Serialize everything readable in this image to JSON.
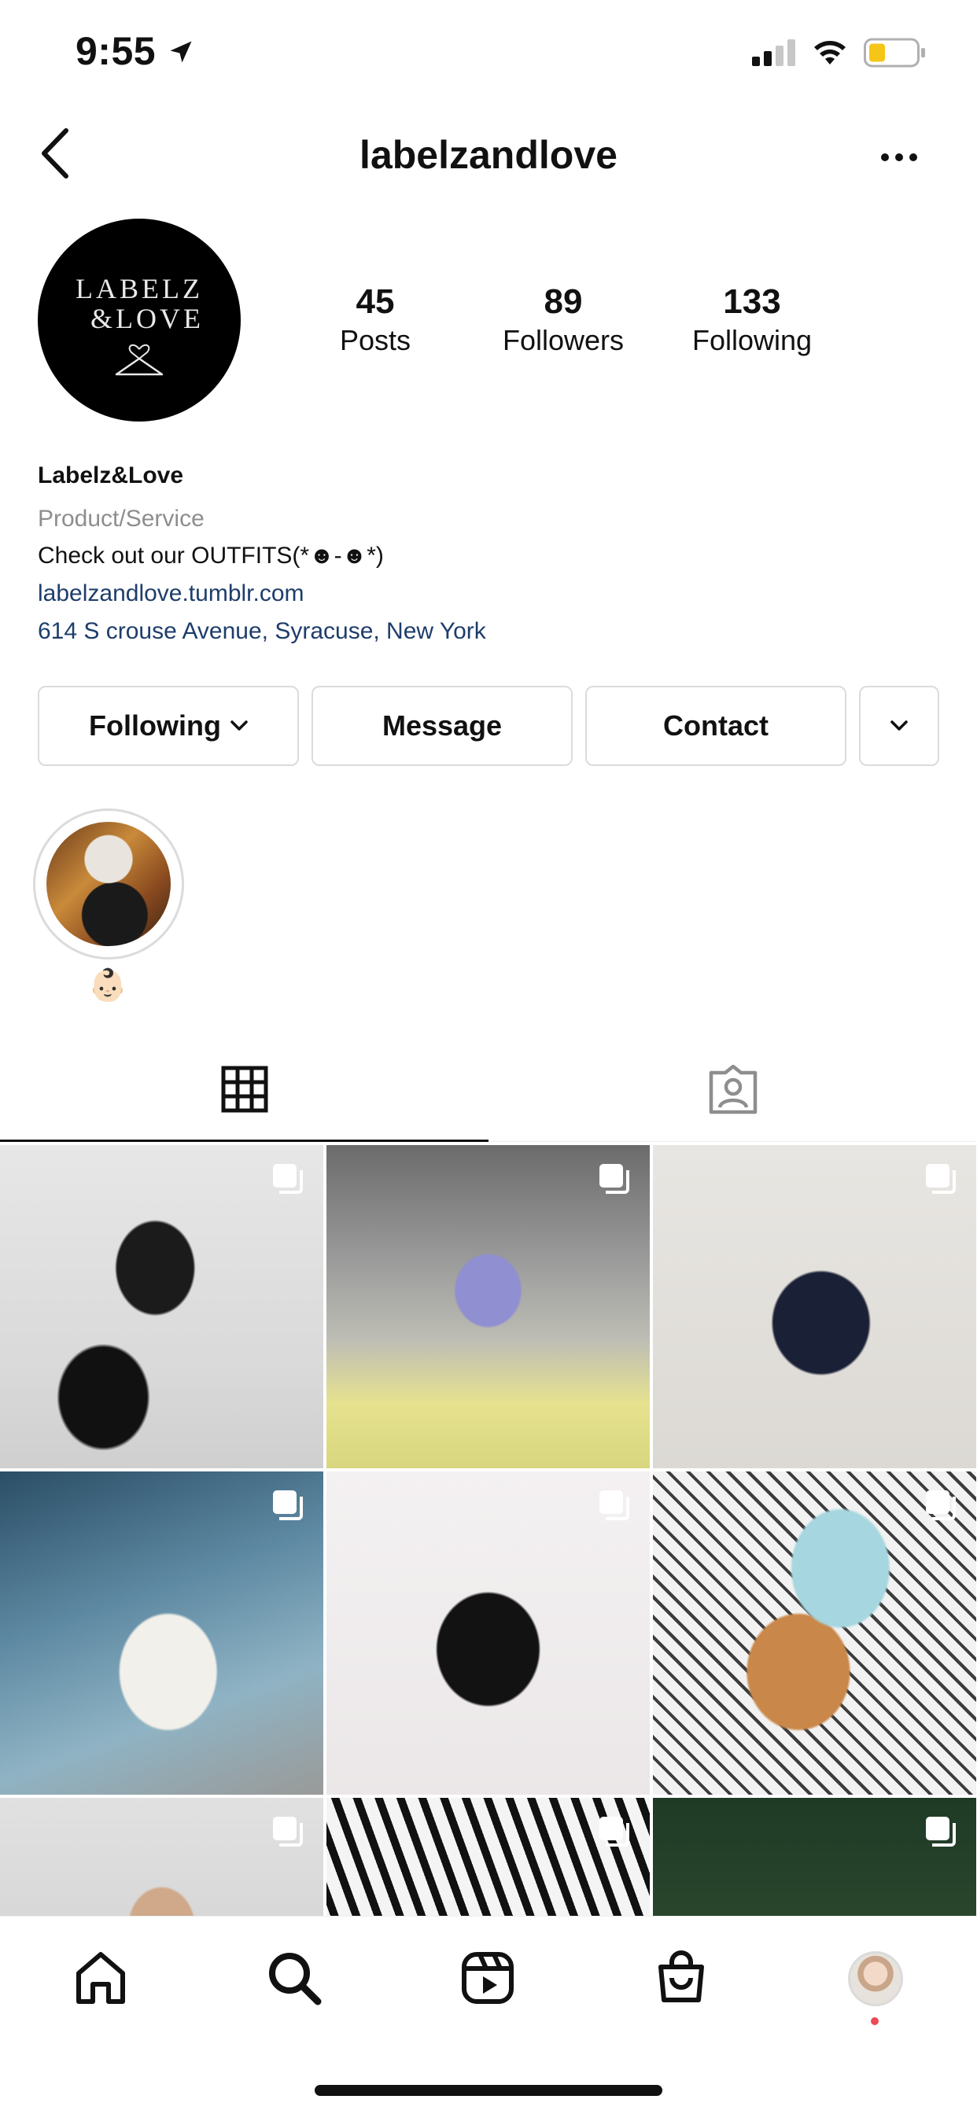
{
  "status_bar": {
    "time": "9:55",
    "icons": [
      "location-arrow-icon",
      "cellular-signal-icon",
      "wifi-icon",
      "battery-icon"
    ]
  },
  "header": {
    "username": "labelzandlove",
    "icons": [
      "back-arrow-icon",
      "more-options-icon"
    ]
  },
  "profile": {
    "avatar_text_line1": "LABELZ",
    "avatar_text_line2": "&LOVE",
    "stats": [
      {
        "value": "45",
        "label": "Posts"
      },
      {
        "value": "89",
        "label": "Followers"
      },
      {
        "value": "133",
        "label": "Following"
      }
    ],
    "name": "Labelz&Love",
    "category": "Product/Service",
    "bio": "Check out our OUTFITS(*☻-☻*)",
    "website": "labelzandlove.tumblr.com",
    "address": "614 S crouse Avenue, Syracuse, New York"
  },
  "actions": {
    "following_label": "Following",
    "message_label": "Message",
    "contact_label": "Contact"
  },
  "highlights": [
    {
      "label": "👶🏻"
    }
  ],
  "tabs": [
    {
      "name": "posts-grid",
      "icon": "grid-icon",
      "active": true
    },
    {
      "name": "tagged",
      "icon": "tagged-person-icon",
      "active": false
    }
  ],
  "bottom_nav": {
    "icons": [
      "home-icon",
      "search-icon",
      "reels-icon",
      "shop-icon",
      "profile-avatar"
    ]
  },
  "colors": {
    "link": "#1e3d6b",
    "muted": "#8e8e8e",
    "border": "#dbdbdb",
    "notification_dot": "#ed4956"
  }
}
